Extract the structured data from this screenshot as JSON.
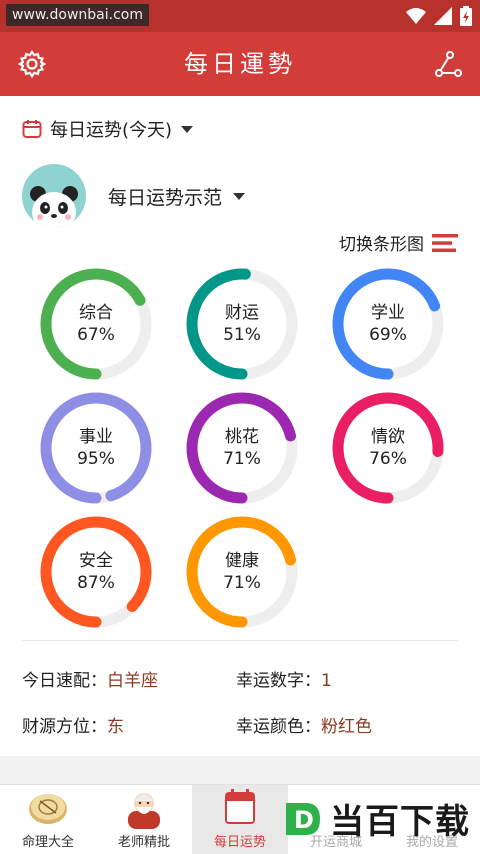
{
  "status_bar": {
    "watermark": "www.downbai.com"
  },
  "app_bar": {
    "title": "每日運勢",
    "settings_icon": "gear-icon",
    "share_icon": "share-icon"
  },
  "date_selector": {
    "label": "每日运势(今天)"
  },
  "profile": {
    "name": "每日运势示范"
  },
  "view_switch": {
    "label": "切换条形图"
  },
  "fortunes": [
    {
      "name": "综合",
      "value": "67%",
      "percent": 67,
      "color": "#4caf50"
    },
    {
      "name": "财运",
      "value": "51%",
      "percent": 51,
      "color": "#009688"
    },
    {
      "name": "学业",
      "value": "69%",
      "percent": 69,
      "color": "#4285f4"
    },
    {
      "name": "事业",
      "value": "95%",
      "percent": 95,
      "color": "#8e8ee6"
    },
    {
      "name": "桃花",
      "value": "71%",
      "percent": 71,
      "color": "#9c27b0"
    },
    {
      "name": "情欲",
      "value": "76%",
      "percent": 76,
      "color": "#e91e63"
    },
    {
      "name": "安全",
      "value": "87%",
      "percent": 87,
      "color": "#ff5722"
    },
    {
      "name": "健康",
      "value": "71%",
      "percent": 71,
      "color": "#ff9800"
    }
  ],
  "info": {
    "speed_match_label": "今日速配：",
    "speed_match_value": "白羊座",
    "lucky_number_label": "幸运数字：",
    "lucky_number_value": "1",
    "wealth_dir_label": "财源方位：",
    "wealth_dir_value": "东",
    "lucky_color_label": "幸运颜色：",
    "lucky_color_value": "粉红色"
  },
  "tabs": [
    {
      "label": "命理大全"
    },
    {
      "label": "老师精批"
    },
    {
      "label": "每日运势"
    },
    {
      "label": "开运商城"
    },
    {
      "label": "我的设置"
    }
  ],
  "brand": {
    "logo_letter": "D",
    "text": "当百下载"
  },
  "colors": {
    "primary": "#d23c39",
    "value_text": "#8b3a1f",
    "ring_track": "#eeeeee"
  }
}
